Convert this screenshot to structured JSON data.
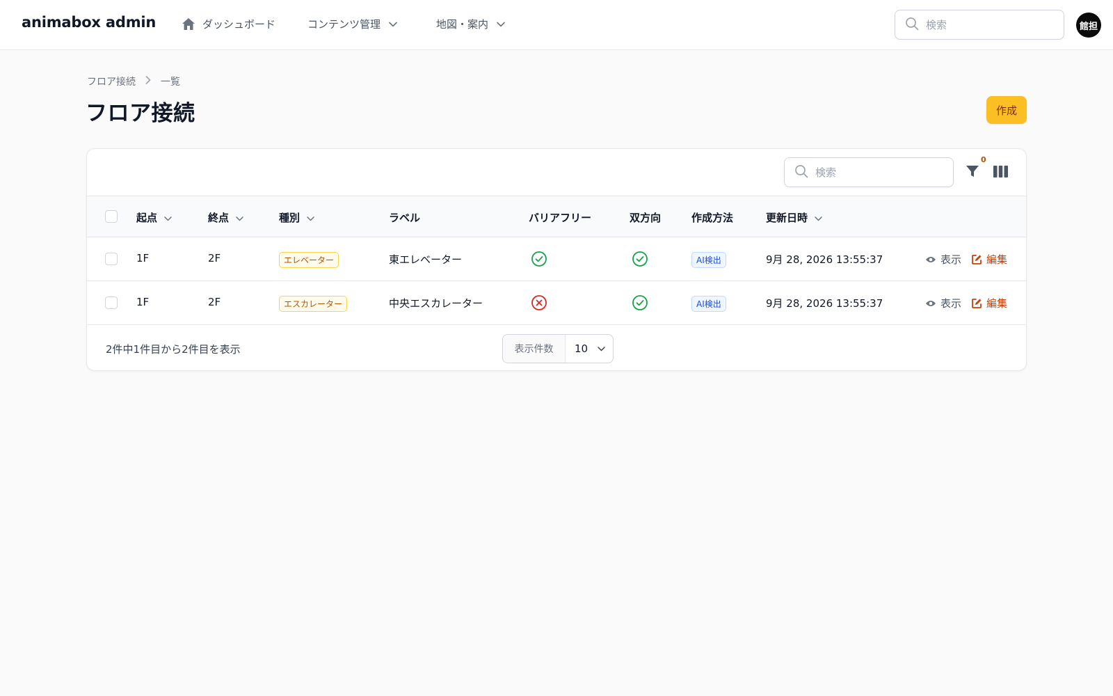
{
  "brand": "animabox admin",
  "nav": {
    "dashboard": "ダッシュボード",
    "content": "コンテンツ管理",
    "map": "地図・案内"
  },
  "top_search": {
    "placeholder": "検索"
  },
  "user": {
    "avatar": "館担"
  },
  "breadcrumb": {
    "parent": "フロア接続",
    "current": "一覧"
  },
  "page": {
    "title": "フロア接続",
    "create_label": "作成"
  },
  "table": {
    "search_placeholder": "検索",
    "filter_count": "0",
    "columns": {
      "from": "起点",
      "to": "終点",
      "type": "種別",
      "label": "ラベル",
      "barrier_free": "バリアフリー",
      "bidirectional": "双方向",
      "method": "作成方法",
      "updated": "更新日時"
    },
    "rows": [
      {
        "from": "1F",
        "to": "2F",
        "type": "エレベーター",
        "label": "東エレベーター",
        "barrier_free": true,
        "bidirectional": true,
        "method": "AI検出",
        "updated": "9月 28, 2026 13:55:37",
        "view": "表示",
        "edit": "編集"
      },
      {
        "from": "1F",
        "to": "2F",
        "type": "エスカレーター",
        "label": "中央エスカレーター",
        "barrier_free": false,
        "bidirectional": true,
        "method": "AI検出",
        "updated": "9月 28, 2026 13:55:37",
        "view": "表示",
        "edit": "編集"
      }
    ],
    "summary": "2件中1件目から2件目を表示",
    "per_page_label": "表示件数",
    "per_page_value": "10"
  },
  "colors": {
    "accent": "#fbbf24",
    "success": "#16a34a",
    "danger": "#dc2626",
    "edit": "#c2410c"
  }
}
